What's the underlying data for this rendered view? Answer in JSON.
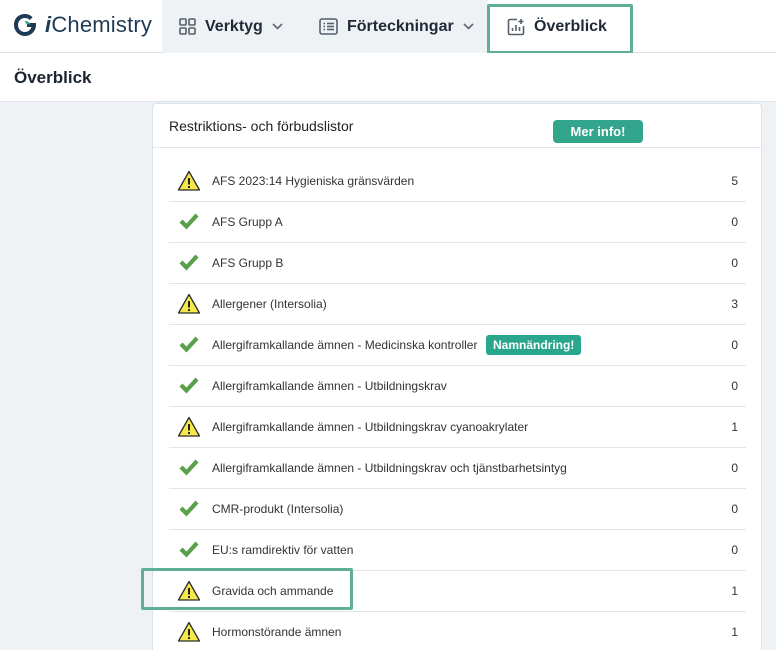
{
  "app": {
    "logo_prefix": "i",
    "logo_name": "Chemistry"
  },
  "nav": {
    "items": [
      {
        "label": "Verktyg",
        "icon": "grid-icon",
        "has_dropdown": true
      },
      {
        "label": "Förteckningar",
        "icon": "list-icon",
        "has_dropdown": true
      },
      {
        "label": "Överblick",
        "icon": "chart-icon",
        "has_dropdown": false,
        "highlighted": true
      }
    ]
  },
  "page": {
    "title": "Överblick"
  },
  "card": {
    "title": "Restriktions- och förbudslistor",
    "info_button": "Mer info!",
    "rows": [
      {
        "name": "AFS 2023:14 Hygieniska gränsvärden",
        "count": "5",
        "status": "warning"
      },
      {
        "name": "AFS Grupp A",
        "count": "0",
        "status": "ok"
      },
      {
        "name": "AFS Grupp B",
        "count": "0",
        "status": "ok"
      },
      {
        "name": "Allergener (Intersolia)",
        "count": "3",
        "status": "warning"
      },
      {
        "name": "Allergiframkallande ämnen - Medicinska kontroller",
        "count": "0",
        "status": "ok",
        "badge": "Namnändring!"
      },
      {
        "name": "Allergiframkallande ämnen - Utbildningskrav",
        "count": "0",
        "status": "ok"
      },
      {
        "name": "Allergiframkallande ämnen - Utbildningskrav cyanoakrylater",
        "count": "1",
        "status": "warning"
      },
      {
        "name": "Allergiframkallande ämnen - Utbildningskrav och tjänstbarhetsintyg",
        "count": "0",
        "status": "ok"
      },
      {
        "name": "CMR-produkt (Intersolia)",
        "count": "0",
        "status": "ok"
      },
      {
        "name": "EU:s ramdirektiv för vatten",
        "count": "0",
        "status": "ok"
      },
      {
        "name": "Gravida och ammande",
        "count": "1",
        "status": "warning",
        "highlighted": true
      },
      {
        "name": "Hormonstörande ämnen",
        "count": "1",
        "status": "warning"
      }
    ]
  },
  "colors": {
    "accent": "#33a58c",
    "highlight": "#5fae96",
    "warning": "#f6e84a",
    "ok": "#5aa04a"
  }
}
